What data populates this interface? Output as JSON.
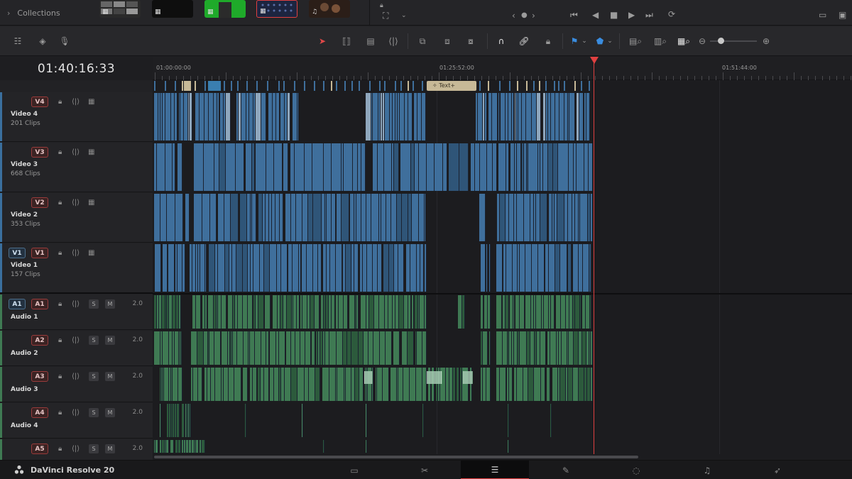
{
  "collections": {
    "label": "Collections"
  },
  "thumbnails": [
    {
      "icon": "film-strip-icon"
    },
    {
      "icon": "film-strip-icon"
    },
    {
      "icon": "film-strip-icon"
    },
    {
      "icon": "film-strip-icon"
    },
    {
      "icon": "music-note-icon"
    }
  ],
  "timecode": "01:40:16:33",
  "ruler": {
    "marks": [
      "01:00:00:00",
      "01:25:52:00",
      "01:51:44:00"
    ]
  },
  "tracks": {
    "video": [
      {
        "id": "V4",
        "name": "Video 4",
        "count": "201 Clips"
      },
      {
        "id": "V3",
        "name": "Video 3",
        "count": "668 Clips"
      },
      {
        "id": "V2",
        "name": "Video 2",
        "count": "353 Clips"
      },
      {
        "id": "V1",
        "src": "V1",
        "name": "Video 1",
        "count": "157 Clips"
      }
    ],
    "audio": [
      {
        "id": "A1",
        "src": "A1",
        "name": "Audio 1",
        "channels": "2.0",
        "solo": "S",
        "mute": "M"
      },
      {
        "id": "A2",
        "name": "Audio 2",
        "channels": "2.0",
        "solo": "S",
        "mute": "M"
      },
      {
        "id": "A3",
        "name": "Audio 3",
        "channels": "2.0",
        "solo": "S",
        "mute": "M"
      },
      {
        "id": "A4",
        "name": "Audio 4",
        "channels": "2.0",
        "solo": "S",
        "mute": "M"
      },
      {
        "id": "A5",
        "name": "",
        "channels": "2.0",
        "solo": "S",
        "mute": "M"
      }
    ]
  },
  "text_clip": {
    "label": "Text+"
  },
  "brand": {
    "name": "DaVinci Resolve 20"
  },
  "pages": [
    {
      "icon": "media-page-icon",
      "glyph": "▭"
    },
    {
      "icon": "cut-page-icon",
      "glyph": "✂"
    },
    {
      "icon": "edit-page-icon",
      "glyph": "☰"
    },
    {
      "icon": "fusion-page-icon",
      "glyph": "✎"
    },
    {
      "icon": "color-page-icon",
      "glyph": "◌"
    },
    {
      "icon": "fairlight-page-icon",
      "glyph": "♫"
    },
    {
      "icon": "deliver-page-icon",
      "glyph": "➶"
    }
  ],
  "colors": {
    "video_clip": "#3f6f9c",
    "audio_clip": "#3f7a53",
    "playhead": "#e04040",
    "accent_blue": "#3a8de0",
    "active_tool": "#e04848"
  }
}
